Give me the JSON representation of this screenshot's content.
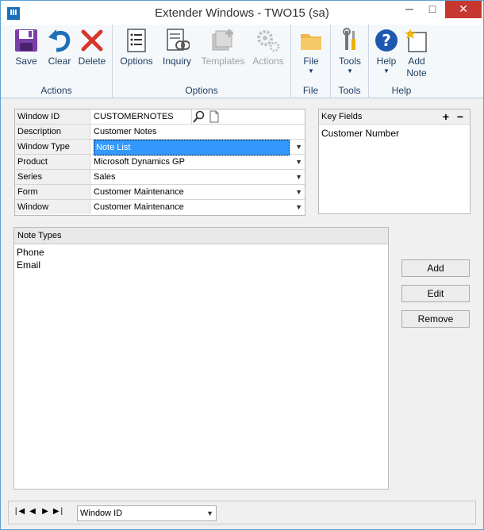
{
  "window": {
    "title": "Extender Windows  -  TWO15 (sa)",
    "app_icon": "dynamics-gp-icon",
    "minimize": "─",
    "maximize": "□",
    "close": "✕"
  },
  "ribbon": {
    "groups": [
      {
        "label": "Actions",
        "buttons": [
          "Save",
          "Clear",
          "Delete"
        ]
      },
      {
        "label": "Options",
        "buttons": [
          "Options",
          "Inquiry",
          "Templates",
          "Actions"
        ]
      },
      {
        "label": "File",
        "buttons": [
          "File"
        ]
      },
      {
        "label": "Tools",
        "buttons": [
          "Tools"
        ]
      },
      {
        "label": "Help",
        "buttons": [
          "Help",
          "Add",
          "Note"
        ]
      }
    ]
  },
  "form": {
    "window_id_label": "Window ID",
    "window_id_value": "CUSTOMERNOTES",
    "description_label": "Description",
    "description_value": "Customer Notes",
    "window_type_label": "Window Type",
    "window_type_value": "Note List",
    "product_label": "Product",
    "product_value": "Microsoft Dynamics GP",
    "series_label": "Series",
    "series_value": "Sales",
    "form_label": "Form",
    "form_value": "Customer Maintenance",
    "window_label": "Window",
    "window_value": "Customer Maintenance"
  },
  "key_fields": {
    "header": "Key Fields",
    "plus": "+",
    "minus": "−",
    "items": [
      "Customer Number"
    ]
  },
  "note_types": {
    "header": "Note Types",
    "items": [
      "Phone",
      "Email"
    ]
  },
  "buttons": {
    "add": "Add",
    "edit": "Edit",
    "remove": "Remove"
  },
  "bottom": {
    "sort_value": "Window ID",
    "nav": [
      "first",
      "previous",
      "next",
      "last"
    ]
  },
  "colors": {
    "accent": "#3399ff",
    "close_button": "#c7372f",
    "ribbon_text": "#1f3f62"
  }
}
